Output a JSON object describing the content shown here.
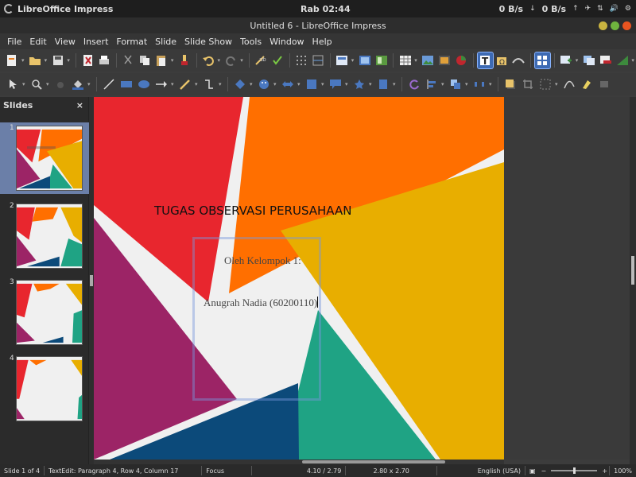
{
  "system": {
    "app_name": "LibreOffice Impress",
    "clock": "Rab 02:44",
    "net_down": "0 B/s",
    "net_up": "0 B/s",
    "download_arrow": "↓",
    "upload_arrow": "↑"
  },
  "window": {
    "title": "Untitled 6 - LibreOffice Impress",
    "close_color": "#e95420",
    "min_color": "#e0c040",
    "max_color": "#7ac943"
  },
  "menu": [
    "File",
    "Edit",
    "View",
    "Insert",
    "Format",
    "Slide",
    "Slide Show",
    "Tools",
    "Window",
    "Help"
  ],
  "slides_panel": {
    "title": "Slides",
    "close_label": "×",
    "slide_numbers": [
      "1",
      "2",
      "3",
      "4"
    ]
  },
  "slide": {
    "title": "TUGAS OBSERVASI PERUSAHAAN",
    "line1": "Oleh Kelompok 1:",
    "line2": "Anugrah Nadia (60200110)",
    "colors": {
      "red": "#e8262e",
      "orange": "#ff6f00",
      "yellow": "#e8ae00",
      "purple": "#9c2466",
      "teal": "#1fa384",
      "navy": "#0c4a7a",
      "background": "#f0f0f0"
    }
  },
  "status": {
    "slide": "Slide 1 of 4",
    "edit": "TextEdit: Paragraph 4, Row 4, Column 17",
    "focus": "Focus",
    "position": "4.10 / 2.79",
    "size": "2.80 x 2.70",
    "language": "English (USA)",
    "zoom": "100%"
  }
}
